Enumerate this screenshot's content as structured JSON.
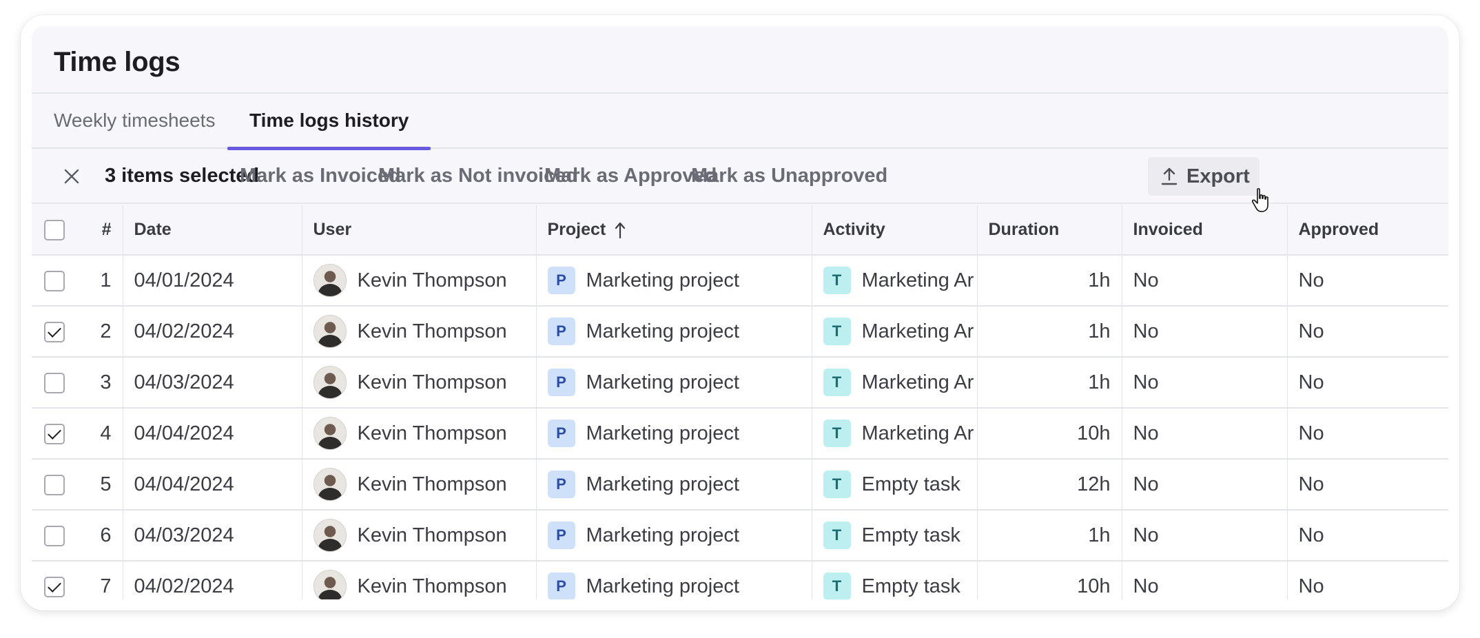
{
  "page": {
    "title": "Time logs"
  },
  "tabs": [
    {
      "label": "Weekly timesheets",
      "active": false
    },
    {
      "label": "Time logs history",
      "active": true
    }
  ],
  "selection": {
    "count_label": "3 items selected",
    "actions": {
      "mark_invoiced": "Mark as Invoiced",
      "mark_not_invoiced": "Mark as Not invoiced",
      "mark_approved": "Mark as Approved",
      "mark_unapproved": "Mark as Unapproved",
      "export": "Export"
    }
  },
  "table": {
    "columns": {
      "num": "#",
      "date": "Date",
      "user": "User",
      "project": "Project",
      "activity": "Activity",
      "duration": "Duration",
      "invoiced": "Invoiced",
      "approved": "Approved"
    },
    "sort": {
      "column": "Project",
      "direction": "ascending"
    },
    "rows": [
      {
        "checked": false,
        "num": "1",
        "date": "04/01/2024",
        "user": "Kevin Thompson",
        "project_badge": "P",
        "project": "Marketing project",
        "activity_badge": "T",
        "activity": "Marketing Ar",
        "duration": "1h",
        "invoiced": "No",
        "approved": "No"
      },
      {
        "checked": true,
        "num": "2",
        "date": "04/02/2024",
        "user": "Kevin Thompson",
        "project_badge": "P",
        "project": "Marketing project",
        "activity_badge": "T",
        "activity": "Marketing Ar",
        "duration": "1h",
        "invoiced": "No",
        "approved": "No"
      },
      {
        "checked": false,
        "num": "3",
        "date": "04/03/2024",
        "user": "Kevin Thompson",
        "project_badge": "P",
        "project": "Marketing project",
        "activity_badge": "T",
        "activity": "Marketing Ar",
        "duration": "1h",
        "invoiced": "No",
        "approved": "No"
      },
      {
        "checked": true,
        "num": "4",
        "date": "04/04/2024",
        "user": "Kevin Thompson",
        "project_badge": "P",
        "project": "Marketing project",
        "activity_badge": "T",
        "activity": "Marketing Ar",
        "duration": "10h",
        "invoiced": "No",
        "approved": "No"
      },
      {
        "checked": false,
        "num": "5",
        "date": "04/04/2024",
        "user": "Kevin Thompson",
        "project_badge": "P",
        "project": "Marketing project",
        "activity_badge": "T",
        "activity": "Empty task",
        "duration": "12h",
        "invoiced": "No",
        "approved": "No"
      },
      {
        "checked": false,
        "num": "6",
        "date": "04/03/2024",
        "user": "Kevin Thompson",
        "project_badge": "P",
        "project": "Marketing project",
        "activity_badge": "T",
        "activity": "Empty task",
        "duration": "1h",
        "invoiced": "No",
        "approved": "No"
      },
      {
        "checked": true,
        "num": "7",
        "date": "04/02/2024",
        "user": "Kevin Thompson",
        "project_badge": "P",
        "project": "Marketing project",
        "activity_badge": "T",
        "activity": "Empty task",
        "duration": "10h",
        "invoiced": "No",
        "approved": "No"
      }
    ]
  },
  "colors": {
    "accent": "#6a5ae0",
    "project_badge_bg": "#cfe0fb",
    "activity_badge_bg": "#bdeef0"
  },
  "icons": {
    "close": "close-icon",
    "export": "upload-icon",
    "sort": "arrow-up-icon",
    "cursor": "hand-pointer-icon"
  }
}
